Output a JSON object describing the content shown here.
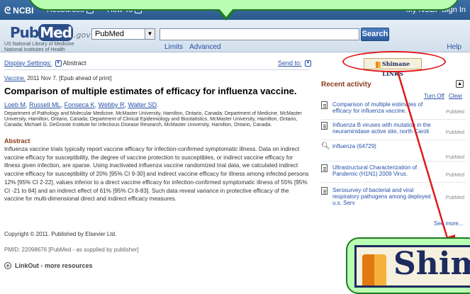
{
  "ncbi_bar": {
    "logo": "NCBI",
    "resources": "Resources",
    "how_to": "How To",
    "my_ncbi": "My NCBI",
    "sign_in": "Sign In"
  },
  "search": {
    "logo_pub": "Pub",
    "logo_med": "Med",
    "logo_gov": ".gov",
    "logo_sub_line1": "US National Library of Medicine",
    "logo_sub_line2": "National Institutes of Health",
    "database": "PubMed",
    "query": "",
    "button": "Search",
    "limits": "Limits",
    "advanced": "Advanced",
    "help": "Help"
  },
  "article": {
    "display_settings": "Display Settings:",
    "display_value": "Abstract",
    "send_to": "Send to:",
    "citation_journal": "Vaccine.",
    "citation_rest": "2011 Nov 7. [Epub ahead of print]",
    "title": "Comparison of multiple estimates of efficacy for influenza vaccine.",
    "authors": [
      "Loeb M",
      "Russell ML",
      "Fonseca K",
      "Webby R",
      "Walter SD"
    ],
    "affiliation": "Department of Pathology and Molecular Medicine, McMaster University, Hamilton, Ontario, Canada; Department of Medicine, McMaster University, Hamilton, Ontario, Canada; Department of Clinical Epidemiology and Biostatistics, McMaster University, Hamilton, Ontario, Canada; Michael G. DeGroote Institute for Infectious Disease Research, McMaster University, Hamilton, Ontario, Canada.",
    "abstract_heading": "Abstract",
    "abstract": "Influenza vaccine trials typically report vaccine efficacy for infection-confirmed symptomatic illness. Data on indirect vaccine efficacy for susceptibility, the degree of vaccine protection to susceptibles, or indirect vaccine efficacy for illness given infection, are sparse. Using inactivated influenza vaccine randomized trial data, we calculated indirect vaccine efficacy for susceptibility of 20% [95% CI 9-30] and indirect vaccine efficacy for illness among infected persons 12% [95% CI 2-22], values inferior to a direct vaccine efficacy for infection-confirmed symptomatic illness of 55% [95% CI -21 to 84] and an indirect effect of 61% [95% CI 8-83]. Such data reveal variance in protective efficacy of the vaccine for multi-dimensional direct and indirect efficacy measures.",
    "copyright": "Copyright © 2011. Published by Elsevier Ltd.",
    "pmid": "PMID: 22098676 [PubMed - as supplied by publisher]",
    "linkout": "LinkOut - more resources"
  },
  "sidebar": {
    "shimane_links": "Shimane LINKS",
    "recent_activity_heading": "Recent activity",
    "turn_off": "Turn Off",
    "clear": "Clear",
    "items": [
      {
        "text": "Comparison of multiple estimates of efficacy for influenza vaccine.",
        "source": "PubMed",
        "icon": "document-icon"
      },
      {
        "text": "Influenza B viruses with mutation in the neuraminidase active site, north Caroli",
        "source": "PubMed",
        "icon": "document-icon"
      },
      {
        "text": "influenza (64729)",
        "source": "PubMed",
        "icon": "search-icon"
      },
      {
        "text": "Ultrastructural Characterization of Pandemic (H1N1) 2009 Virus.",
        "source": "PubMed",
        "icon": "document-icon"
      },
      {
        "text": "Serosurvey of bacterial and viral respiratory pathogens among deployed u.s. Serv",
        "source": "PubMed",
        "icon": "document-icon"
      }
    ],
    "see_more": "See more..."
  },
  "overlay": {
    "zoomed_text": "Shim",
    "accent_red": "#e01a1a",
    "callout_green": "#b9fdb3"
  }
}
